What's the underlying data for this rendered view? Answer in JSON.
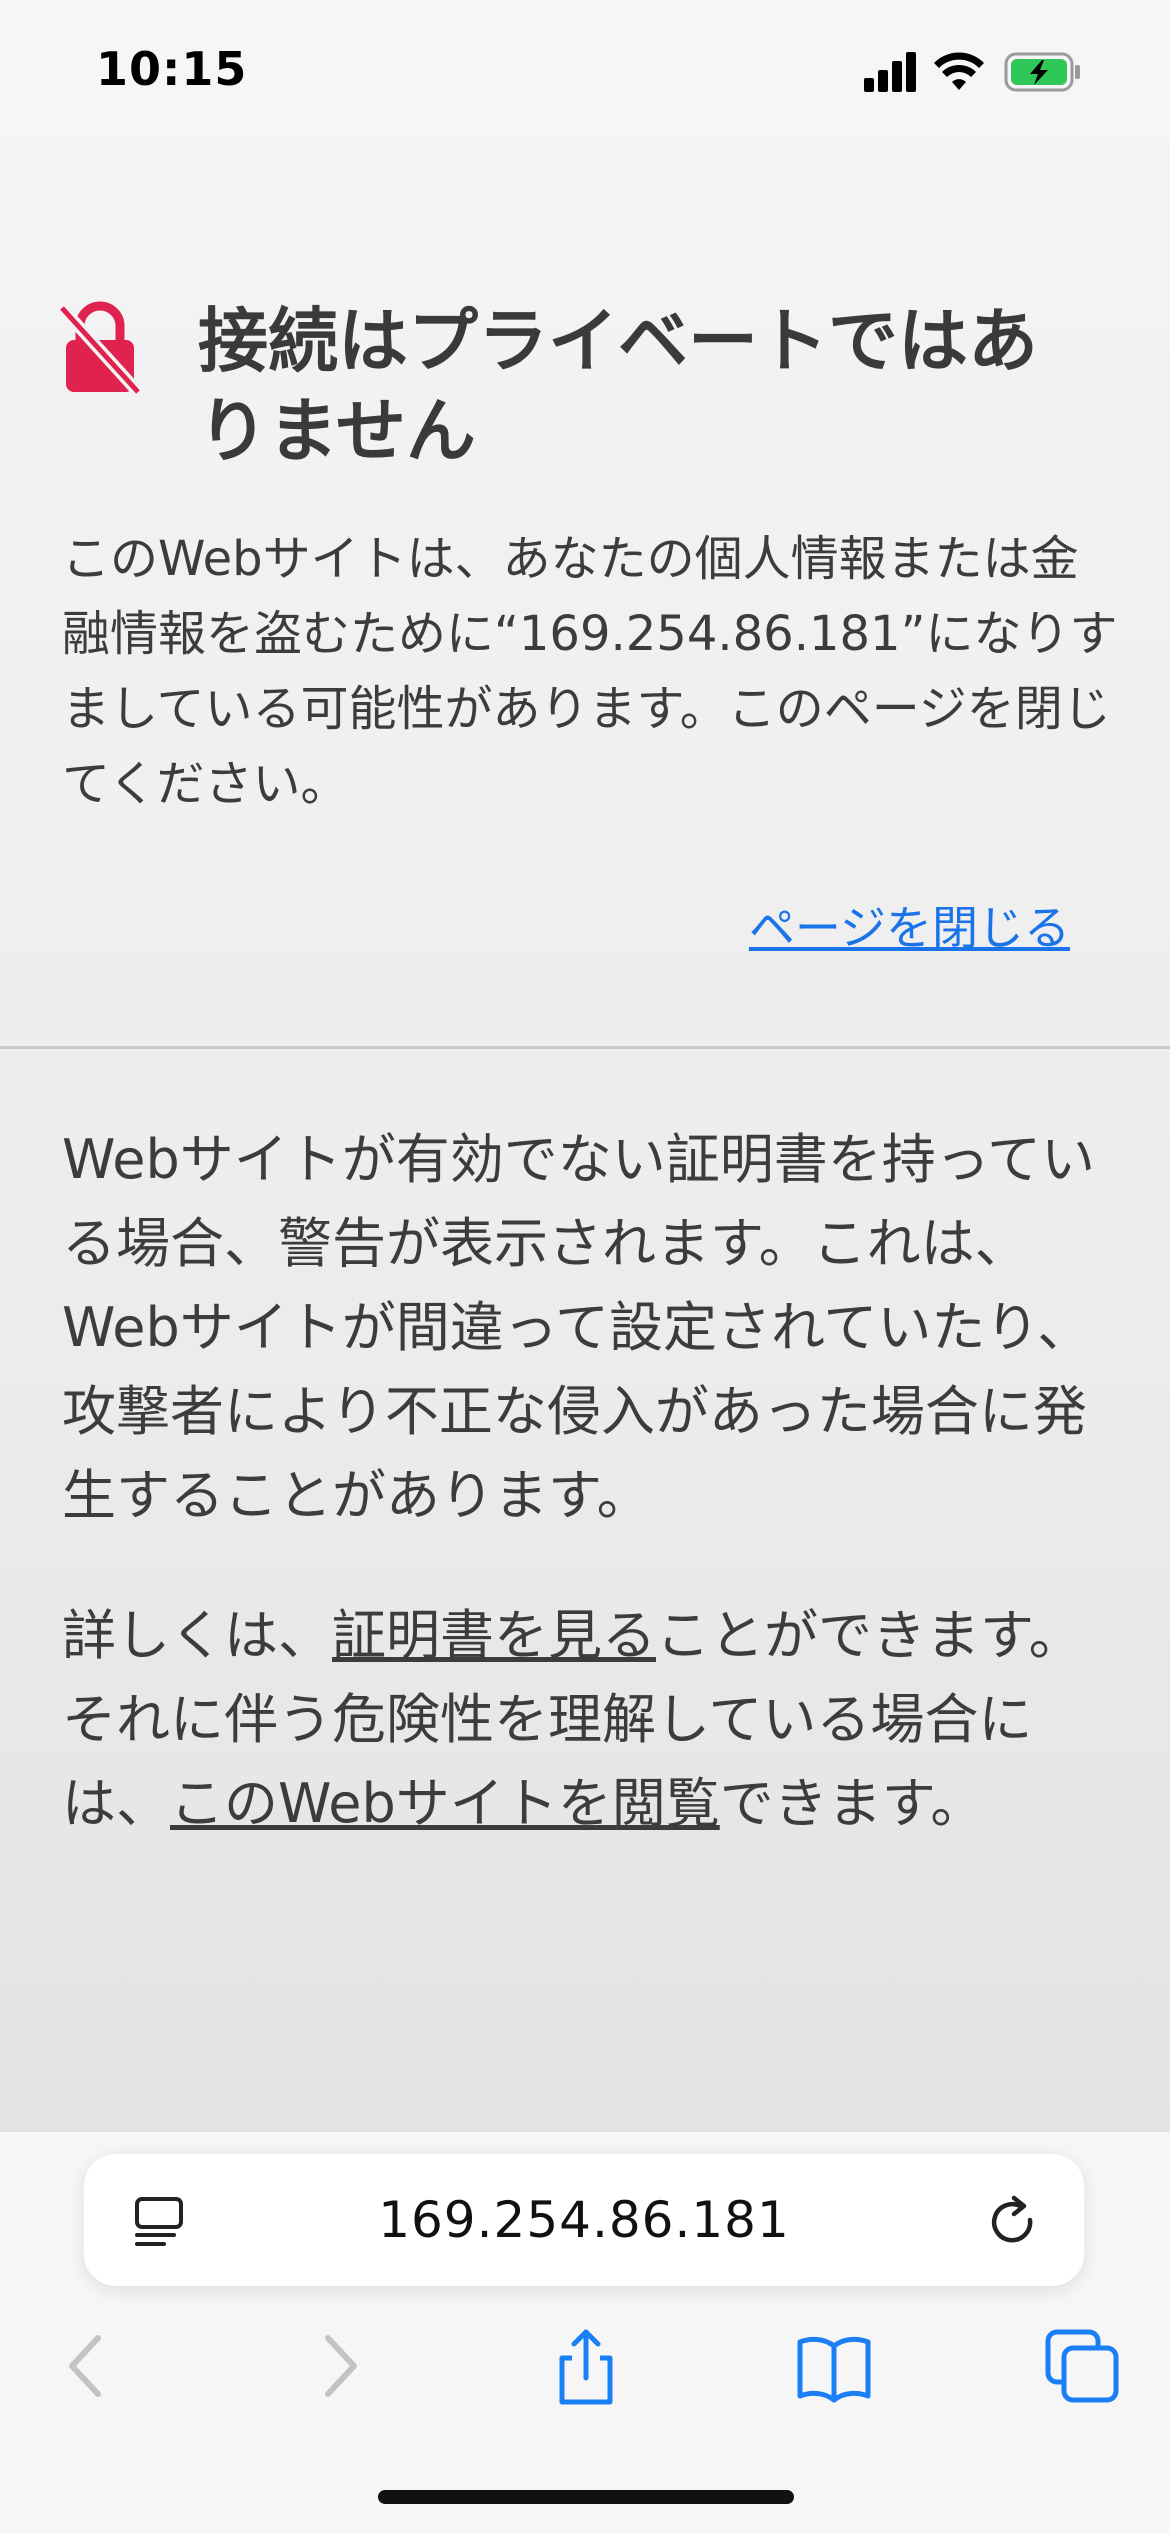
{
  "status_bar": {
    "time": "10:15",
    "icons": [
      "cellular-signal-icon",
      "wifi-icon",
      "battery-charging-icon"
    ],
    "battery_color": "#30c759"
  },
  "warning": {
    "icon": "lock-slash-icon",
    "icon_color": "#e0234e",
    "title": "接続はプライベートではありません",
    "body": "このWebサイトは、あなたの個人情報または金融情報を盗むために“169.254.86.181”になりすましている可能性があります。このページを閉じてください。",
    "close_link": "ページを閉じる",
    "link_color": "#1a73e8"
  },
  "explanation": {
    "text": "Webサイトが有効でない証明書を持っている場合、警告が表示されます。これは、Webサイトが間違って設定されていたり、攻撃者により不正な侵入があった場合に発生することがあります。"
  },
  "details": {
    "prefix": "詳しくは、",
    "view_certificate_link": "証明書を見る",
    "middle": "ことができます。 それに伴う危険性を理解している場合には、",
    "visit_site_link": "このWebサイトを閲覧",
    "suffix": "できます。"
  },
  "address_bar": {
    "url": "169.254.86.181",
    "left_icon": "reader-view-icon",
    "right_icon": "reload-icon"
  },
  "toolbar": {
    "items": [
      "back-icon",
      "forward-icon",
      "share-icon",
      "bookmarks-icon",
      "tabs-icon"
    ],
    "accent": "#1a7ff5",
    "disabled": "#c3c3c7"
  }
}
